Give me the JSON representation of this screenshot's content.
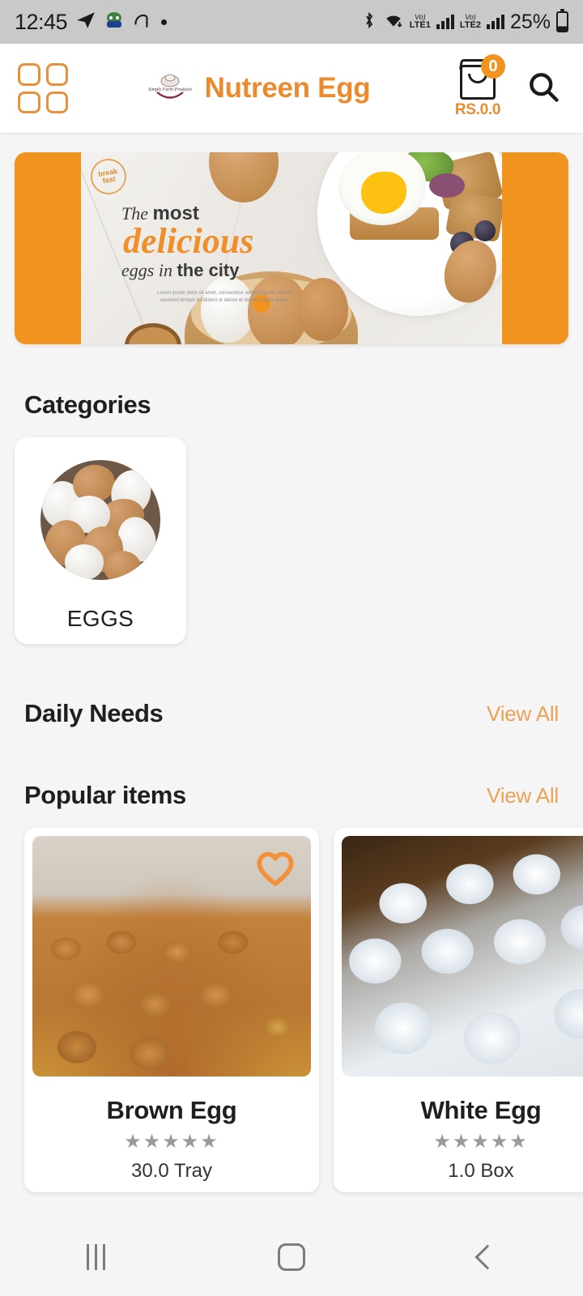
{
  "status_bar": {
    "time": "12:45",
    "icons": [
      "telegram-icon",
      "app-icon",
      "sound-icon",
      "dot-icon"
    ],
    "bluetooth": "bluetooth-icon",
    "wifi": "wifi-icon",
    "sim1_volte": "Vo)",
    "sim1_network": "LTE1",
    "sim2_volte": "Vo)",
    "sim2_network": "LTE2",
    "battery_percent": "25%"
  },
  "header": {
    "menu_icon": "grid-menu-icon",
    "logo_text": "Simply Farm Products",
    "title": "Nutreen Egg",
    "cart": {
      "icon": "shopping-bag-icon",
      "badge_count": "0",
      "total": "RS.0.0"
    },
    "search_icon": "search-icon"
  },
  "banner": {
    "badge": "break fast",
    "line1_plain": "The ",
    "line1_bold": "most",
    "line2": "delicious",
    "line3_plain": "eggs in ",
    "line3_bold": "the city",
    "subtext": "Lorem ipsum dolor sit amet, consectetur adipiscing elit, sed do eiusmod tempor incididunt ut labore et dolore magna aliqua"
  },
  "sections": {
    "categories": {
      "title": "Categories"
    },
    "daily_needs": {
      "title": "Daily Needs",
      "view_all": "View All"
    },
    "popular_items": {
      "title": "Popular items",
      "view_all": "View All"
    }
  },
  "categories": [
    {
      "label": "EGGS",
      "image": "mixed-eggs-photo"
    }
  ],
  "popular_items": [
    {
      "name": "Brown Egg",
      "rating_stars": "★★★★★",
      "unit": "30.0 Tray",
      "favorited": true,
      "image": "brown-eggs-trays-photo"
    },
    {
      "name": "White Egg",
      "rating_stars": "★★★★★",
      "unit": "1.0 Box",
      "favorited": false,
      "image": "white-eggs-carton-photo"
    }
  ],
  "nav_bar": {
    "recent_label": "recent-apps-button",
    "home_label": "home-button",
    "back_label": "back-button"
  },
  "colors": {
    "accent_orange": "#ec8b2e",
    "view_all_orange": "#eaa257",
    "badge_orange": "#f0941f",
    "text_dark": "#1f1f1f",
    "page_bg": "#f5f5f5",
    "star_gray": "#9a9a9a"
  }
}
